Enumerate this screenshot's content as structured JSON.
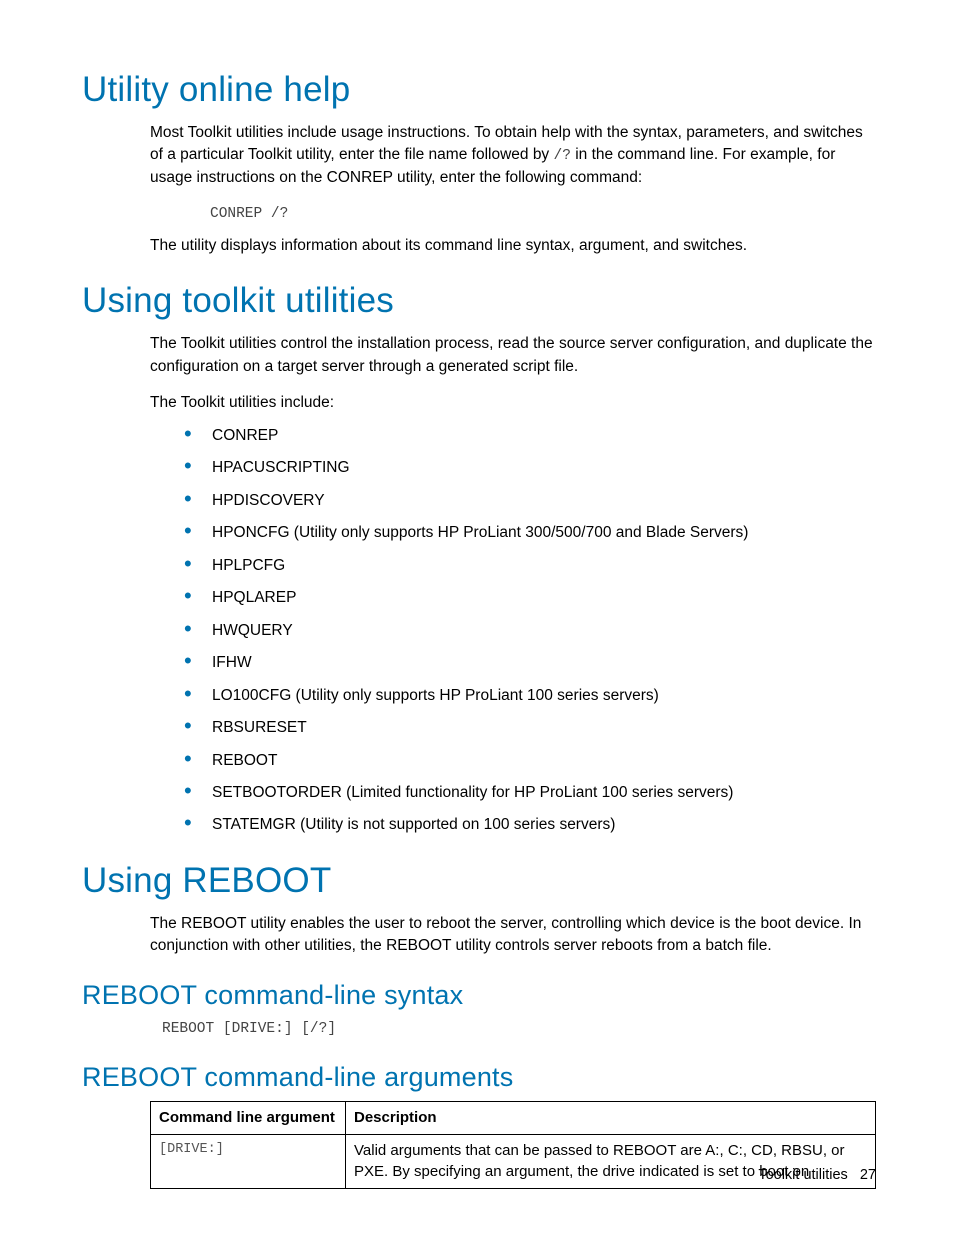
{
  "sections": {
    "utility_online_help": {
      "title": "Utility online help",
      "para1_pre": "Most Toolkit utilities include usage instructions. To obtain help with the syntax, parameters, and switches of a particular Toolkit utility, enter the file name followed by ",
      "para1_code": "/?",
      "para1_post": " in the command line. For example, for usage instructions on the CONREP utility, enter the following command:",
      "code": "CONREP /?",
      "para2": "The utility displays information about its command line syntax, argument, and switches."
    },
    "using_toolkit": {
      "title": "Using toolkit utilities",
      "para1": "The Toolkit utilities control the installation process, read the source server configuration, and duplicate the configuration on a target server through a generated script file.",
      "para2": "The Toolkit utilities include:",
      "items": [
        "CONREP",
        "HPACUSCRIPTING",
        "HPDISCOVERY",
        "HPONCFG (Utility only supports HP ProLiant 300/500/700 and Blade Servers)",
        "HPLPCFG",
        "HPQLAREP",
        "HWQUERY",
        "IFHW",
        "LO100CFG (Utility only supports HP ProLiant 100 series servers)",
        "RBSURESET",
        "REBOOT",
        "SETBOOTORDER (Limited functionality for HP ProLiant 100 series servers)",
        "STATEMGR (Utility is not supported on 100 series servers)"
      ]
    },
    "using_reboot": {
      "title": "Using REBOOT",
      "para1": "The REBOOT utility enables the user to reboot the server, controlling which device is the boot device. In conjunction with other utilities, the REBOOT utility controls server reboots from a batch file."
    },
    "reboot_syntax": {
      "title": "REBOOT command-line syntax",
      "code": "REBOOT [DRIVE:] [/?]"
    },
    "reboot_args": {
      "title": "REBOOT command-line arguments",
      "table": {
        "headers": [
          "Command line argument",
          "Description"
        ],
        "rows": [
          {
            "arg": "[DRIVE:]",
            "desc": "Valid arguments that can be passed to REBOOT are A:, C:, CD, RBSU, or PXE. By specifying an argument, the drive indicated is set to boot on"
          }
        ]
      }
    }
  },
  "footer": {
    "label": "Toolkit utilities",
    "page": "27"
  }
}
